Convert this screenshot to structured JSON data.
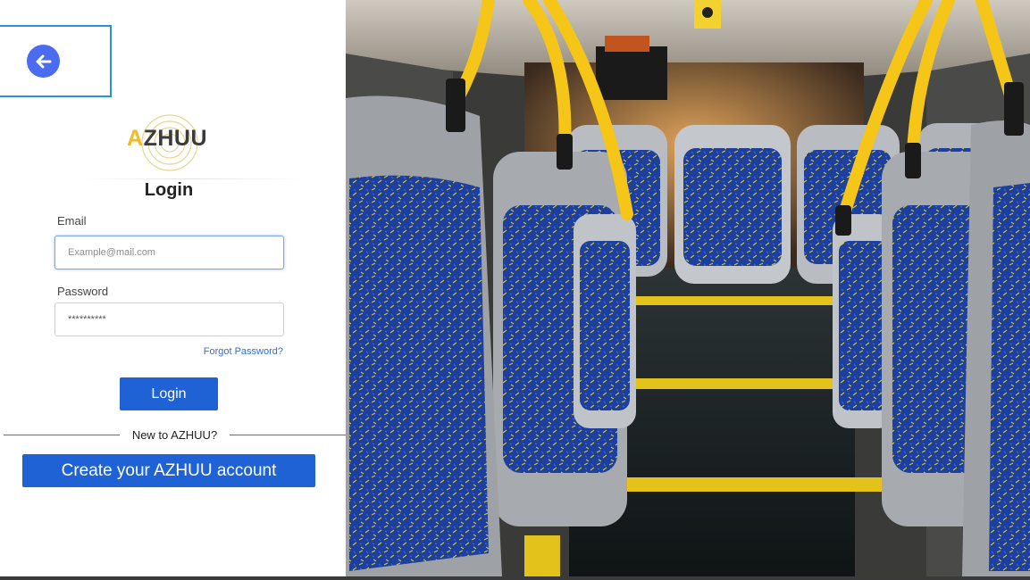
{
  "brand": {
    "logo_prefix": "A",
    "logo_rest": "ZHUU"
  },
  "login": {
    "title": "Login",
    "email_label": "Email",
    "email_placeholder": "Example@mail.com",
    "password_label": "Password",
    "password_value": "**********",
    "forgot_link": "Forgot Password?",
    "login_button": "Login",
    "divider_text": "New to AZHUU?",
    "create_button": "Create your AZHUU account"
  },
  "colors": {
    "primary": "#1f62d6",
    "back_button": "#4b6bf0",
    "focus_box": "#2a8ee6",
    "logo_accent": "#f2b928",
    "seat_fabric": "#1c3fa0",
    "handrail": "#f5c518"
  },
  "icons": {
    "back": "arrow-left-icon"
  }
}
